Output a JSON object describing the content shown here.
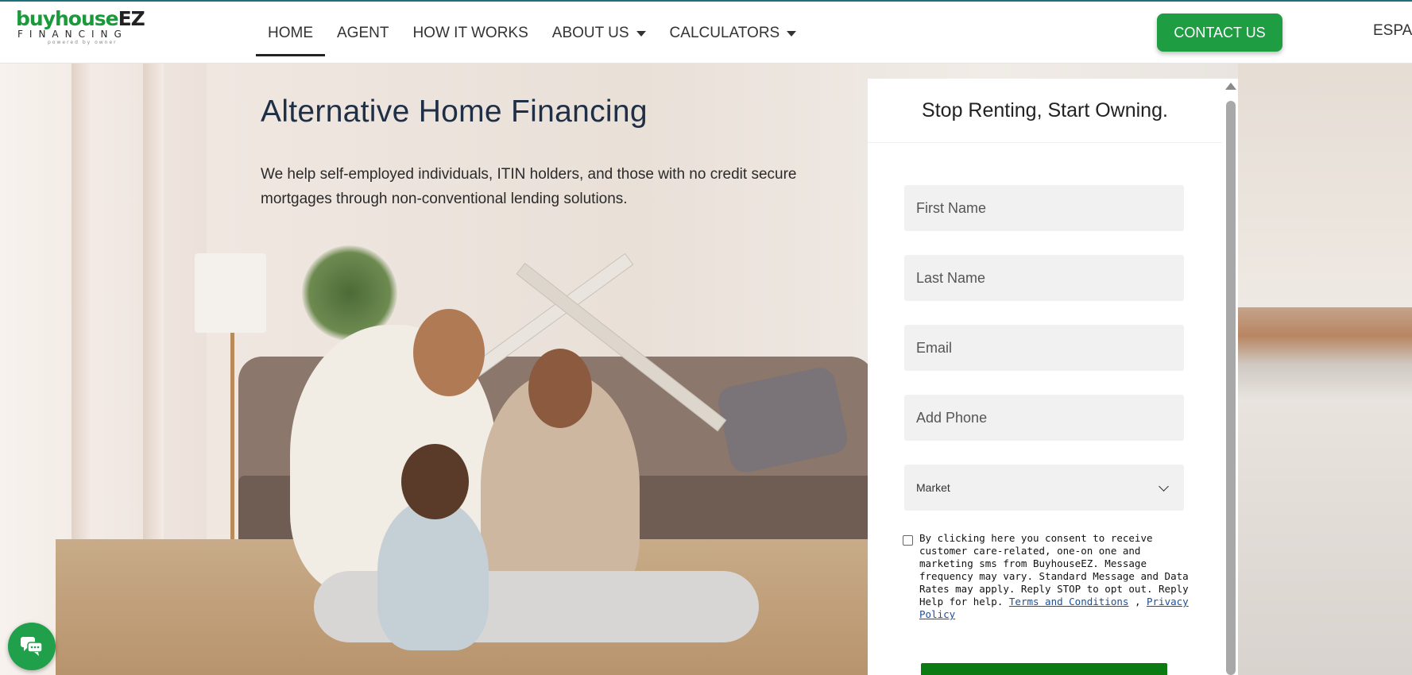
{
  "header": {
    "logo": {
      "part1": "buyhouse",
      "part2": "EZ",
      "line2": "FINANCING",
      "tagline": "powered by owner"
    },
    "nav": [
      {
        "label": "HOME",
        "active": true
      },
      {
        "label": "AGENT"
      },
      {
        "label": "HOW IT WORKS"
      },
      {
        "label": "ABOUT US",
        "dropdown": true
      },
      {
        "label": "CALCULATORS",
        "dropdown": true
      }
    ],
    "contact_label": "CONTACT US",
    "language_label": "ESPA",
    "colors": {
      "accent": "#1f9d43",
      "text": "#333333"
    }
  },
  "hero": {
    "title": "Alternative Home Financing",
    "subtitle": "We help self-employed individuals, ITIN holders, and those with no credit secure mortgages through non-conventional lending solutions."
  },
  "form": {
    "title": "Stop Renting, Start Owning.",
    "first_name_placeholder": "First Name",
    "last_name_placeholder": "Last Name",
    "email_placeholder": "Email",
    "phone_placeholder": "Add Phone",
    "market_selected": "Market",
    "consent_text": "By clicking here you consent to receive customer care-related, one-on one and marketing sms from BuyhouseEZ. Message frequency may vary. Standard Message and Data Rates may apply. Reply STOP to opt out. Reply Help for help.",
    "terms_link": "Terms and Conditions",
    "separator": ",",
    "privacy_link": "Privacy Policy",
    "consent_checked": false,
    "submit_color": "#0b7a12"
  },
  "chat": {
    "icon": "chat-bubbles-icon",
    "color": "#20a04a"
  }
}
